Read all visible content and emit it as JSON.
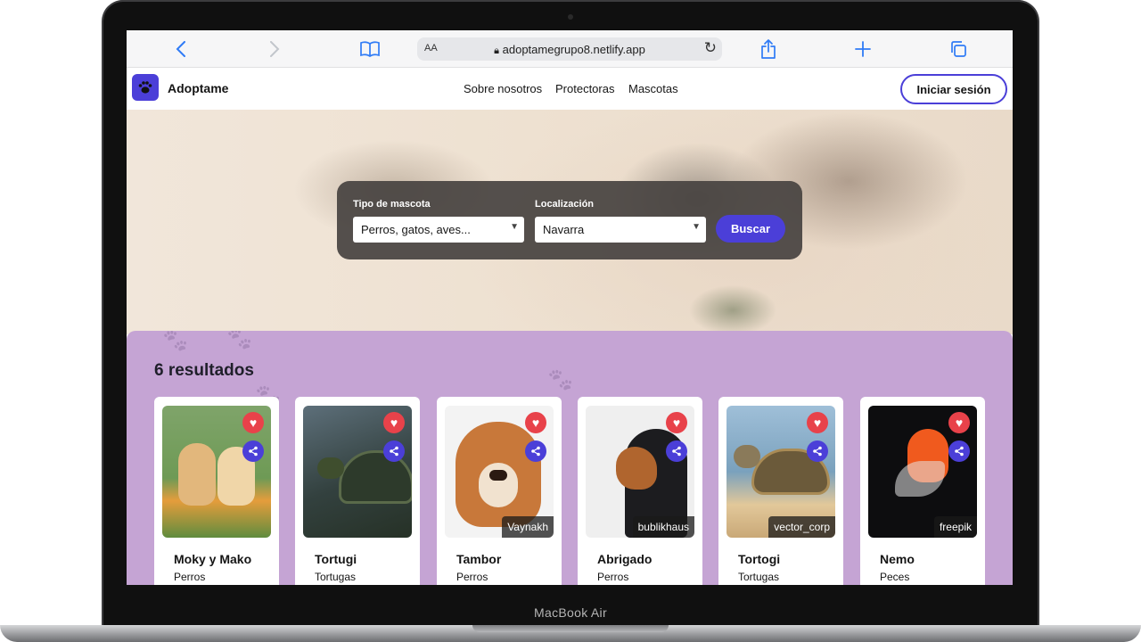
{
  "device": {
    "label": "MacBook Air"
  },
  "browser": {
    "text_size_label": "AA",
    "url": "adoptamegrupo8.netlify.app",
    "icons": [
      "back-icon",
      "forward-icon",
      "bookmarks-icon",
      "lock-icon",
      "reload-icon",
      "share-icon",
      "new-tab-icon",
      "tabs-icon"
    ]
  },
  "header": {
    "brand": "Adoptame",
    "nav": [
      "Sobre nosotros",
      "Protectoras",
      "Mascotas"
    ],
    "login_label": "Iniciar sesión"
  },
  "search": {
    "type_label": "Tipo de mascota",
    "type_value": "Perros, gatos, aves...",
    "location_label": "Localización",
    "location_value": "Navarra",
    "button_label": "Buscar"
  },
  "results": {
    "title": "6 resultados",
    "cards": [
      {
        "name": "Moky y Mako",
        "type": "Perros",
        "credit": ""
      },
      {
        "name": "Tortugi",
        "type": "Tortugas",
        "credit": ""
      },
      {
        "name": "Tambor",
        "type": "Perros",
        "credit": "Vaynakh"
      },
      {
        "name": "Abrigado",
        "type": "Perros",
        "credit": "bublikhaus"
      },
      {
        "name": "Tortogi",
        "type": "Tortugas",
        "credit": "vector_corp"
      },
      {
        "name": "Nemo",
        "type": "Peces",
        "credit": "freepik"
      }
    ]
  },
  "colors": {
    "accent": "#4b3fd8",
    "favorite": "#e8424a",
    "results_bg": "#c5a4d4",
    "search_panel": "#46423f"
  }
}
